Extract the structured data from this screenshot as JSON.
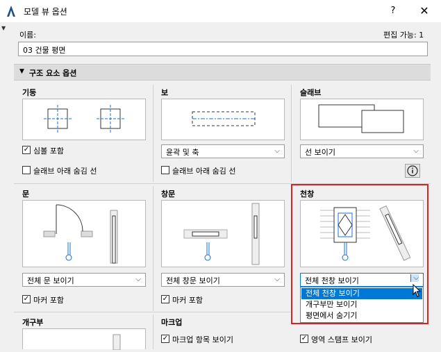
{
  "window": {
    "title": "모델 뷰 옵션",
    "help_label": "?",
    "close_label": "✕"
  },
  "name_field": {
    "label": "이름:",
    "editable_text": "편집 가능: 1",
    "value": "03 건물 평면"
  },
  "section": {
    "title": "구조 요소 옵션"
  },
  "groups": {
    "column": {
      "title": "기둥",
      "checkbox1": {
        "label": "심볼 포함",
        "checked": true
      },
      "checkbox2": {
        "label": "슬래브 아래 숨김 선",
        "checked": false
      }
    },
    "beam": {
      "title": "보",
      "dropdown": "윤곽 및 축",
      "checkbox": {
        "label": "슬래브 아래 숨김 선",
        "checked": false
      }
    },
    "slab": {
      "title": "슬래브",
      "dropdown": "선 보이기"
    },
    "door": {
      "title": "문",
      "dropdown": "전체 문 보이기",
      "checkbox": {
        "label": "마커 포함",
        "checked": true
      }
    },
    "window": {
      "title": "창문",
      "dropdown": "전체 창문 보이기",
      "checkbox": {
        "label": "마커 포함",
        "checked": true
      }
    },
    "skylight": {
      "title": "천창",
      "dropdown": "전체 천창 보이기",
      "options": [
        "전체 천창 보이기",
        "개구부만 보이기",
        "평면에서 숨기기"
      ]
    },
    "opening": {
      "title": "개구부"
    },
    "marker": {
      "title": "마크업",
      "checkbox": {
        "label": "마크업 항목 보이기",
        "checked": true
      }
    },
    "zone": {
      "checkbox": {
        "label": "영역 스탬프 보이기",
        "checked": true
      }
    }
  },
  "colors": {
    "highlight": "#e02020",
    "selection": "#0078d7",
    "marker_blue": "#1a6fd6"
  }
}
